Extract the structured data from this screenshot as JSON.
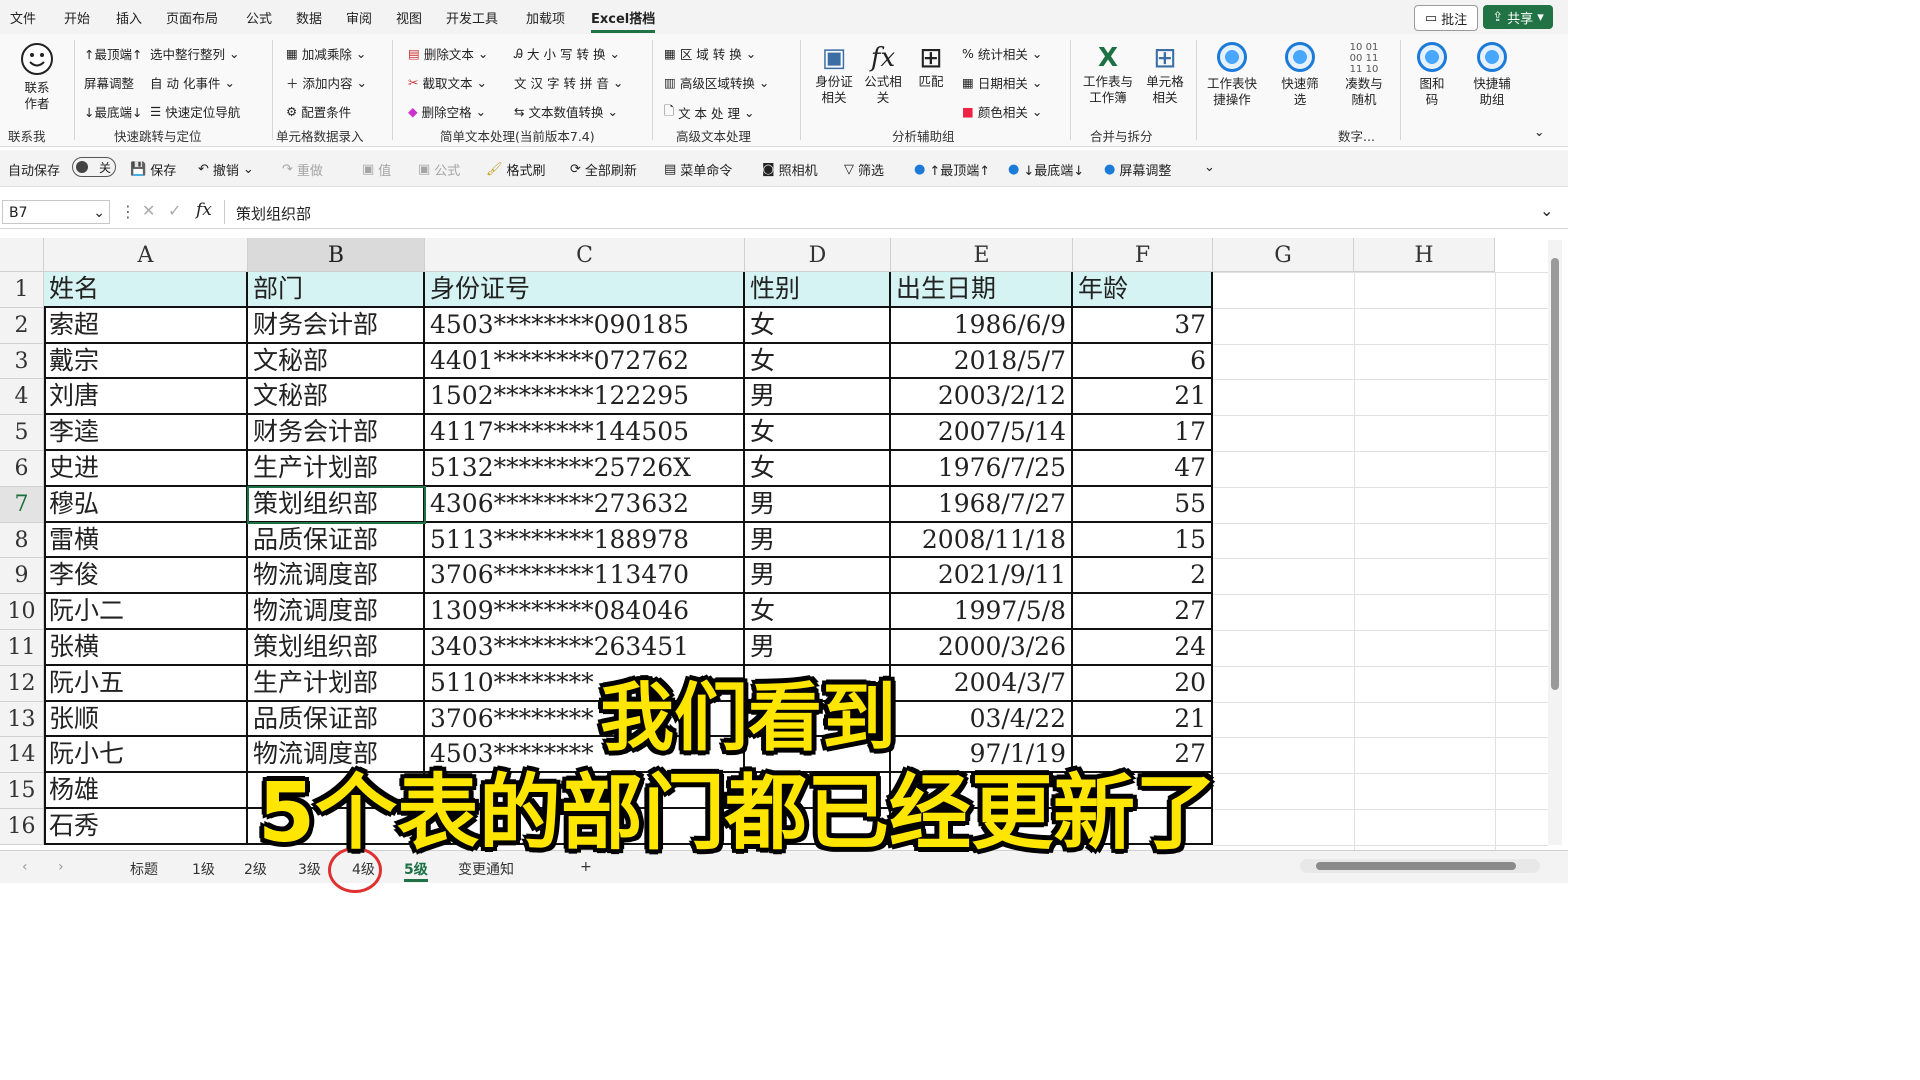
{
  "menu": [
    "文件",
    "开始",
    "插入",
    "页面布局",
    "公式",
    "数据",
    "审阅",
    "视图",
    "开发工具",
    "加载项",
    "Excel搭档"
  ],
  "topright": {
    "comment": "批注",
    "share": "共享"
  },
  "ribbon": {
    "contact": "联系作者",
    "g1": [
      "↑最顶端↑",
      "选中整行整列",
      "屏幕调整",
      "自 动 化事件",
      "↓最底端↓",
      "快速定位导航"
    ],
    "g2": [
      "加减乘除",
      "添加内容",
      "配置条件"
    ],
    "g3": [
      "删除文本",
      "大 小 写 转 换",
      "截取文本",
      "汉 字 转 拼 音",
      "删除空格",
      "文本数值转换"
    ],
    "g4": [
      "区 域 转 换",
      "高级区域转换",
      "文 本 处 理"
    ],
    "g5_big": [
      "身份证相关",
      "公式相关",
      "匹配"
    ],
    "g5": [
      "统计相关",
      "日期相关",
      "颜色相关"
    ],
    "g6_big": [
      "工作表与工作簿",
      "单元格相关"
    ],
    "g7_big": [
      "工作表快捷操作",
      "快速筛选",
      "凑数与随机",
      "图和码",
      "快捷辅助组"
    ],
    "groups": [
      "联系我",
      "快速跳转与定位",
      "单元格数据录入",
      "简单文本处理(当前版本7.4)",
      "高级文本处理",
      "分析辅助组",
      "合并与拆分",
      "数字..."
    ]
  },
  "qat": {
    "autosave": "自动保存",
    "off": "关",
    "save": "保存",
    "undo": "撤销",
    "redo": "重做",
    "value": "值",
    "formula": "公式",
    "format": "格式刷",
    "refresh": "全部刷新",
    "menu": "菜单命令",
    "camera": "照相机",
    "filter": "筛选",
    "top": "↑最顶端↑",
    "bottom": "↓最底端↓",
    "screen": "屏幕调整"
  },
  "formula_bar": {
    "name_box": "B7",
    "content": "策划组织部"
  },
  "columns": [
    "A",
    "B",
    "C",
    "D",
    "E",
    "F",
    "G",
    "H"
  ],
  "rows": [
    "1",
    "2",
    "3",
    "4",
    "5",
    "6",
    "7",
    "8",
    "9",
    "10",
    "11",
    "12",
    "13",
    "14",
    "15",
    "16"
  ],
  "table": [
    [
      "姓名",
      "部门",
      "身份证号",
      "性别",
      "出生日期",
      "年龄"
    ],
    [
      "索超",
      "财务会计部",
      "4503********090185",
      "女",
      "1986/6/9",
      "37"
    ],
    [
      "戴宗",
      "文秘部",
      "4401********072762",
      "女",
      "2018/5/7",
      "6"
    ],
    [
      "刘唐",
      "文秘部",
      "1502********122295",
      "男",
      "2003/2/12",
      "21"
    ],
    [
      "李逵",
      "财务会计部",
      "4117********144505",
      "女",
      "2007/5/14",
      "17"
    ],
    [
      "史进",
      "生产计划部",
      "5132********25726X",
      "女",
      "1976/7/25",
      "47"
    ],
    [
      "穆弘",
      "策划组织部",
      "4306********273632",
      "男",
      "1968/7/27",
      "55"
    ],
    [
      "雷横",
      "品质保证部",
      "5113********188978",
      "男",
      "2008/11/18",
      "15"
    ],
    [
      "李俊",
      "物流调度部",
      "3706********113470",
      "男",
      "2021/9/11",
      "2"
    ],
    [
      "阮小二",
      "物流调度部",
      "1309********084046",
      "女",
      "1997/5/8",
      "27"
    ],
    [
      "张横",
      "策划组织部",
      "3403********263451",
      "男",
      "2000/3/26",
      "24"
    ],
    [
      "阮小五",
      "生产计划部",
      "5110********",
      "",
      "2004/3/7",
      "20"
    ],
    [
      "张顺",
      "品质保证部",
      "3706********",
      "",
      "03/4/22",
      "21"
    ],
    [
      "阮小七",
      "物流调度部",
      "4503********",
      "",
      "97/1/19",
      "27"
    ],
    [
      "杨雄",
      "",
      "",
      "",
      "",
      ""
    ],
    [
      "石秀",
      "",
      "",
      "",
      "",
      ""
    ]
  ],
  "tabs": [
    "标题",
    "1级",
    "2级",
    "3级",
    "4级",
    "5级",
    "变更通知",
    "+"
  ],
  "subtitle": {
    "line1": "我们看到",
    "line2": "5个表的部门都已经更新了"
  }
}
